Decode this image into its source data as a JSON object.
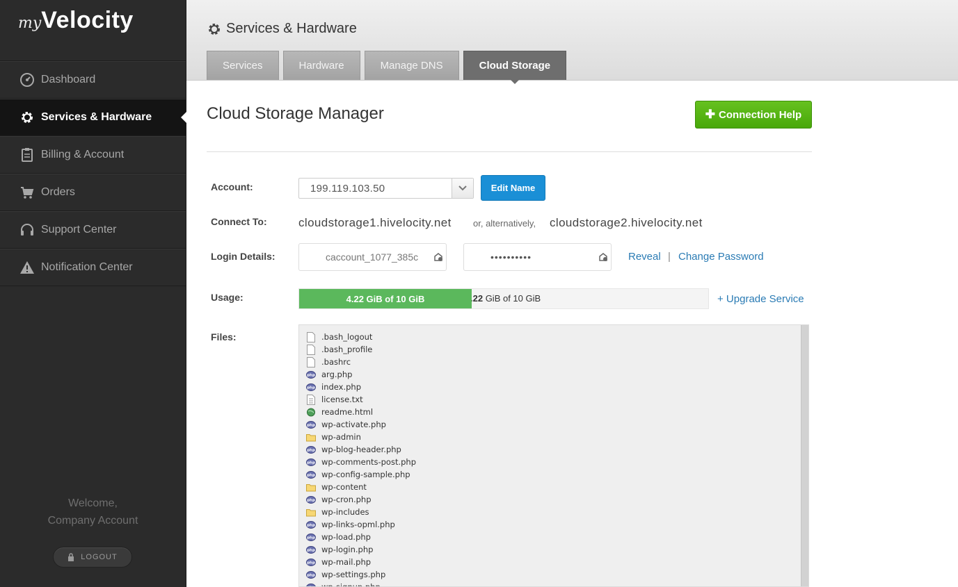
{
  "brand": {
    "prefix": "my",
    "name": "Velocity"
  },
  "sidebar": {
    "items": [
      {
        "label": "Dashboard",
        "icon": "dashboard-gauge-icon",
        "active": false
      },
      {
        "label": "Services & Hardware",
        "icon": "gear-icon",
        "active": true
      },
      {
        "label": "Billing & Account",
        "icon": "clipboard-icon",
        "active": false
      },
      {
        "label": "Orders",
        "icon": "cart-icon",
        "active": false
      },
      {
        "label": "Support Center",
        "icon": "headset-icon",
        "active": false
      },
      {
        "label": "Notification Center",
        "icon": "warning-icon",
        "active": false
      }
    ],
    "welcome_line1": "Welcome,",
    "welcome_line2": "Company Account",
    "logout_label": "LOGOUT"
  },
  "header": {
    "title": "Services & Hardware",
    "tabs": [
      {
        "label": "Services",
        "active": false
      },
      {
        "label": "Hardware",
        "active": false
      },
      {
        "label": "Manage DNS",
        "active": false
      },
      {
        "label": "Cloud Storage",
        "active": true
      }
    ]
  },
  "main": {
    "title": "Cloud Storage Manager",
    "help_button": "Connection Help",
    "account_label": "Account:",
    "account_value": "199.119.103.50",
    "edit_name_button": "Edit Name",
    "connect_label": "Connect To:",
    "host1": "cloudstorage1.hivelocity.net",
    "alt_text": "or, alternatively,",
    "host2": "cloudstorage2.hivelocity.net",
    "login_label": "Login Details:",
    "username": "caccount_1077_385c",
    "password": "••••••••••",
    "reveal_link": "Reveal",
    "separator": "|",
    "change_password_link": "Change Password",
    "usage_label": "Usage:",
    "usage_used": "4.22",
    "usage_text": "4.22 GiB of 10 GiB",
    "usage_text_behind_bold": ".22",
    "usage_text_behind_rest": " GiB of 10 GiB",
    "usage_fraction": 0.422,
    "upgrade_link": "+ Upgrade Service",
    "files_label": "Files:",
    "files": [
      {
        "name": ".bash_logout",
        "type": "file"
      },
      {
        "name": ".bash_profile",
        "type": "file"
      },
      {
        "name": ".bashrc",
        "type": "file"
      },
      {
        "name": "arg.php",
        "type": "php"
      },
      {
        "name": "index.php",
        "type": "php"
      },
      {
        "name": "license.txt",
        "type": "text"
      },
      {
        "name": "readme.html",
        "type": "html"
      },
      {
        "name": "wp-activate.php",
        "type": "php"
      },
      {
        "name": "wp-admin",
        "type": "folder"
      },
      {
        "name": "wp-blog-header.php",
        "type": "php"
      },
      {
        "name": "wp-comments-post.php",
        "type": "php"
      },
      {
        "name": "wp-config-sample.php",
        "type": "php"
      },
      {
        "name": "wp-content",
        "type": "folder"
      },
      {
        "name": "wp-cron.php",
        "type": "php"
      },
      {
        "name": "wp-includes",
        "type": "folder"
      },
      {
        "name": "wp-links-opml.php",
        "type": "php"
      },
      {
        "name": "wp-load.php",
        "type": "php"
      },
      {
        "name": "wp-login.php",
        "type": "php"
      },
      {
        "name": "wp-mail.php",
        "type": "php"
      },
      {
        "name": "wp-settings.php",
        "type": "php"
      },
      {
        "name": "wp-signup.php",
        "type": "php"
      }
    ]
  },
  "colors": {
    "sidebar_bg": "#2b2b2b",
    "active_nav_bg": "#141414",
    "help_green": "#5cb82a",
    "edit_blue": "#1a8fd6",
    "usage_green": "#5bb85c",
    "link_blue": "#2a7bb4"
  }
}
